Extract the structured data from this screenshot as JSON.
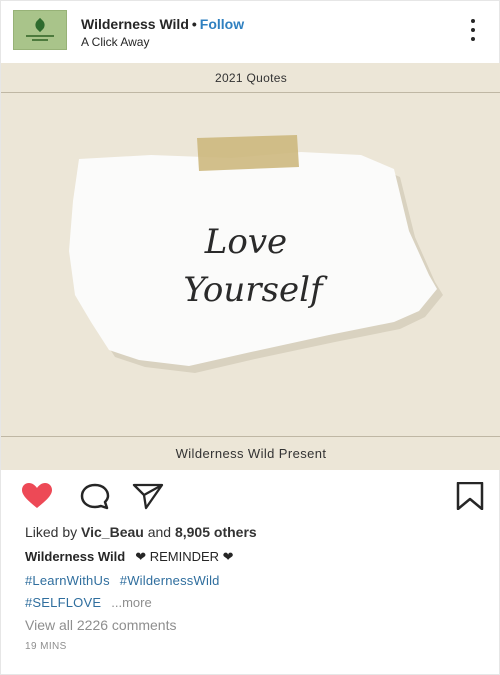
{
  "header": {
    "username": "Wilderness Wild",
    "separator": "•",
    "follow_label": "Follow",
    "subtitle": "A Click Away",
    "avatar_icon": "wilderness-wild-logo"
  },
  "post_image": {
    "top_label": "2021 Quotes",
    "quote": "Love Yourself",
    "bottom_label": "Wilderness Wild Present",
    "background_color": "#ece6d7",
    "tape_color": "#cdb87e"
  },
  "actions": {
    "like_icon": "heart-icon",
    "like_color": "#ed4956",
    "comment_icon": "comment-icon",
    "share_icon": "paper-plane-icon",
    "save_icon": "bookmark-icon"
  },
  "likes": {
    "prefix": "Liked by",
    "user": "Vic_Beau",
    "middle": "and",
    "count": "8,905 others"
  },
  "caption": {
    "username": "Wilderness Wild",
    "text": "❤ REMINDER ❤"
  },
  "hashtags": [
    "#LearnWithUs",
    "#WildernessWild",
    "#SELFLOVE"
  ],
  "more_label": "...more",
  "view_comments": "View all 2226 comments",
  "timestamp": "19 MINS"
}
